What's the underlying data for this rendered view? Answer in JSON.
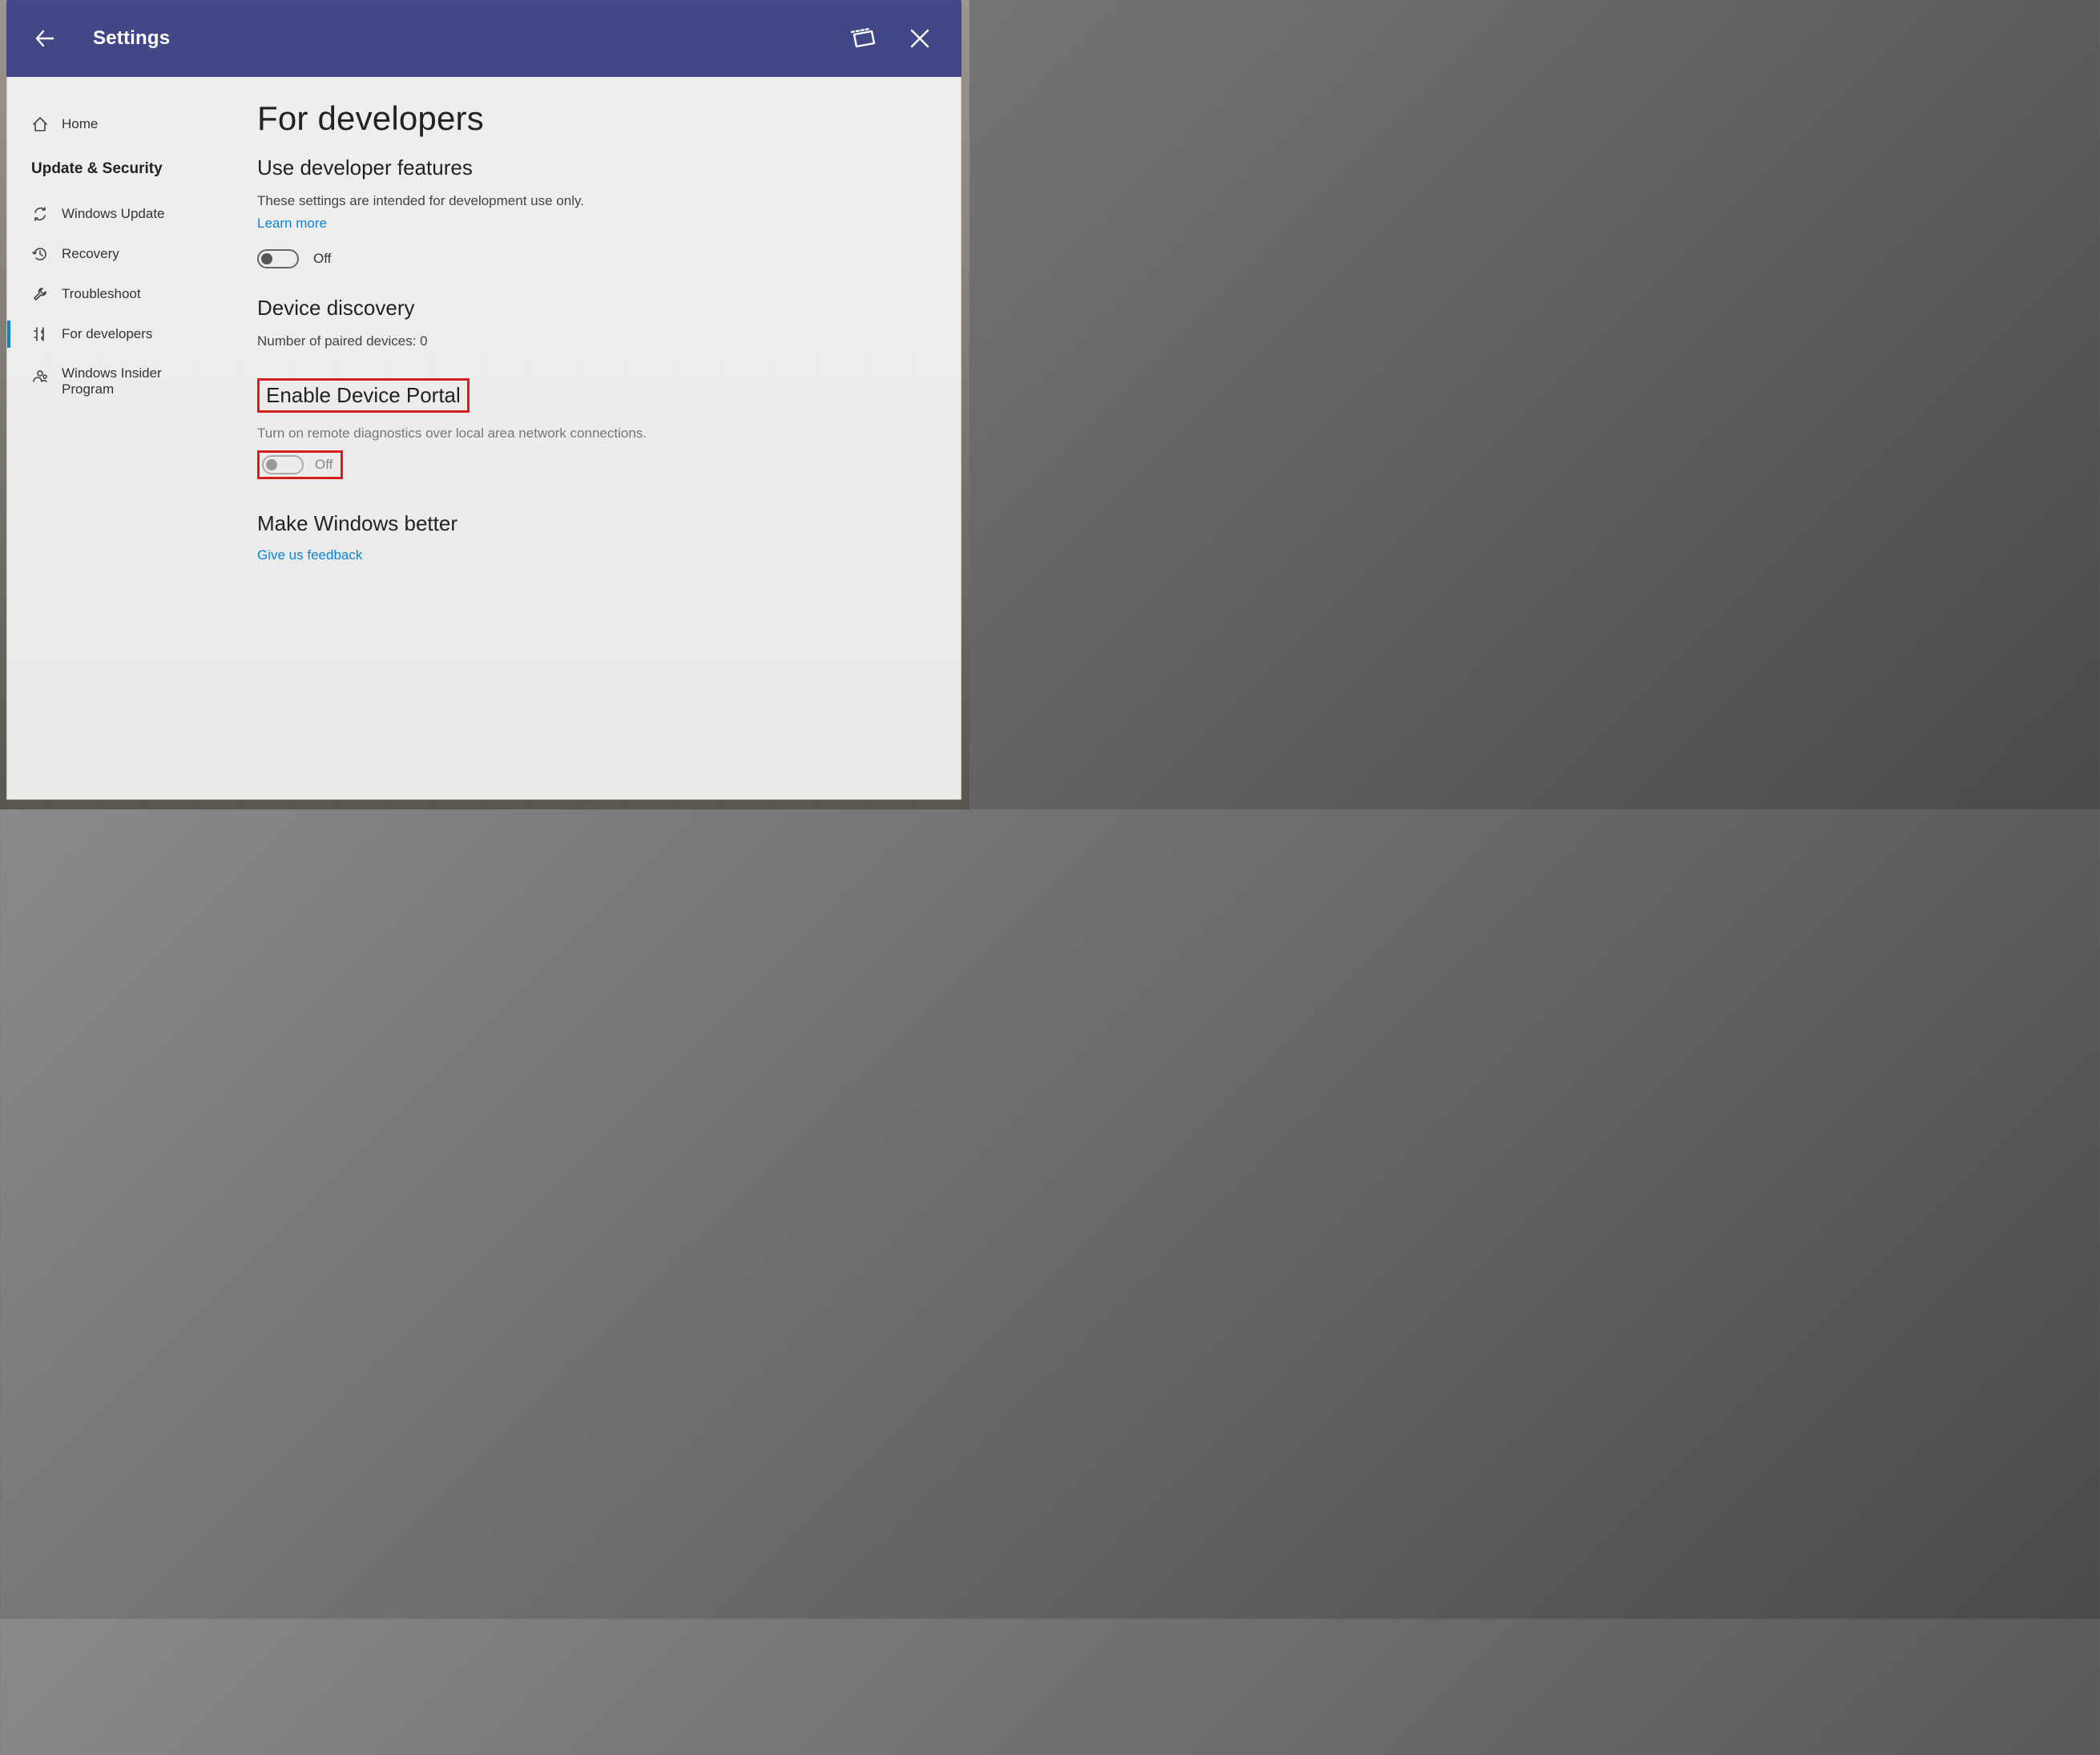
{
  "titlebar": {
    "title": "Settings"
  },
  "sidebar": {
    "home": "Home",
    "section": "Update & Security",
    "items": [
      {
        "label": "Windows Update"
      },
      {
        "label": "Recovery"
      },
      {
        "label": "Troubleshoot"
      },
      {
        "label": "For developers"
      },
      {
        "label": "Windows Insider Program"
      }
    ]
  },
  "main": {
    "page_title": "For developers",
    "dev_features": {
      "heading": "Use developer features",
      "desc": "These settings are intended for development use only.",
      "learn_more": "Learn more",
      "toggle_label": "Off"
    },
    "discovery": {
      "heading": "Device discovery",
      "paired_label": "Number of paired devices: 0"
    },
    "portal": {
      "heading": "Enable Device Portal",
      "desc": "Turn on remote diagnostics over local area network connections.",
      "toggle_label": "Off"
    },
    "feedback": {
      "heading": "Make Windows better",
      "link": "Give us feedback"
    }
  },
  "colors": {
    "accent": "#0b84d4",
    "highlight_box": "#d62020"
  }
}
